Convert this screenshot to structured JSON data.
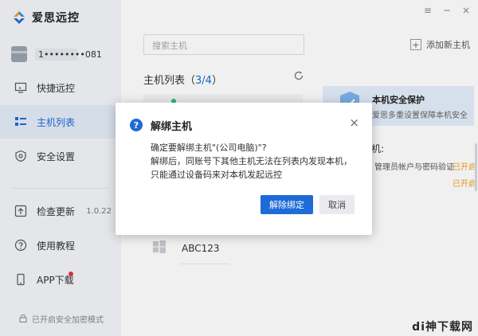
{
  "app": {
    "name": "爱思远控"
  },
  "user": {
    "name": "1••••••••081"
  },
  "sidebar": {
    "items": [
      {
        "label": "快捷远控",
        "icon": "monitor-icon"
      },
      {
        "label": "主机列表",
        "icon": "list-icon",
        "active": true
      },
      {
        "label": "安全设置",
        "icon": "shield-settings-icon"
      },
      {
        "label": "检查更新",
        "icon": "upload-icon",
        "suffix": "1.0.22"
      },
      {
        "label": "使用教程",
        "icon": "help-icon"
      },
      {
        "label": "APP下载",
        "icon": "phone-icon",
        "badge": true
      }
    ],
    "footer": "已开启安全加密模式"
  },
  "window_controls": {
    "menu": "≡",
    "minimize": "−",
    "close": "×"
  },
  "main": {
    "search_placeholder": "搜索主机",
    "add_host": "添加新主机",
    "list_title_prefix": "主机列表（",
    "list_count": "3/4",
    "list_title_suffix": "）",
    "host_name": "ABC123"
  },
  "right_panel": {
    "safe_title": "本机安全保护",
    "safe_desc": "爱思多重设置保障本机安全",
    "perm_label": "机:",
    "rows": [
      {
        "text": "管理员帐户与密码验证",
        "state": "已开启"
      },
      {
        "text": "",
        "state": "已开启"
      }
    ]
  },
  "dialog": {
    "icon": "?",
    "title": "解绑主机",
    "close": "×",
    "line1": "确定要解绑主机\"(公司电脑)\"?",
    "line2": "解绑后，同账号下其他主机无法在列表内发现本机，只能通过设备码来对本机发起远控",
    "confirm": "解除绑定",
    "cancel": "取消"
  },
  "watermark": "di神下载网",
  "colors": {
    "accent": "#1e6bd8",
    "warning": "#f0a020",
    "online": "#2ec26f",
    "badge": "#e8333a"
  }
}
